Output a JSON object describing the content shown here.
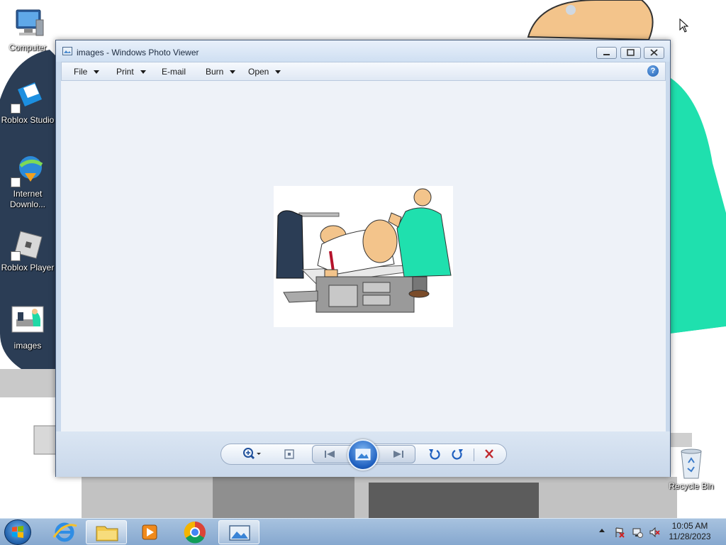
{
  "desktop": {
    "icons": [
      {
        "label": "Computer",
        "icon": "computer-icon"
      },
      {
        "label": "Roblox Studio",
        "icon": "roblox-studio-icon"
      },
      {
        "label": "Internet Downlo...",
        "icon": "internet-download-manager-icon"
      },
      {
        "label": "Roblox Player",
        "icon": "roblox-player-icon"
      },
      {
        "label": "images",
        "icon": "image-file-icon"
      },
      {
        "label": "Recycle Bin",
        "icon": "recycle-bin-icon"
      }
    ]
  },
  "window": {
    "title": "images - Windows Photo Viewer",
    "menu": [
      {
        "label": "File",
        "has_dropdown": true
      },
      {
        "label": "Print",
        "has_dropdown": true
      },
      {
        "label": "E-mail",
        "has_dropdown": false
      },
      {
        "label": "Burn",
        "has_dropdown": true
      },
      {
        "label": "Open",
        "has_dropdown": true
      }
    ],
    "help_symbol": "?",
    "toolbar": {
      "buttons": [
        "zoom-icon",
        "actual-size-icon",
        "previous-icon",
        "slideshow-icon",
        "next-icon",
        "rotate-left-icon",
        "rotate-right-icon",
        "delete-icon"
      ]
    }
  },
  "taskbar": {
    "apps": [
      "file-explorer-icon",
      "internet-explorer-icon",
      "libraries-icon",
      "media-player-icon",
      "chrome-icon",
      "photo-viewer-icon"
    ],
    "active_app": "photo-viewer-icon",
    "clock": {
      "time": "10:05 AM",
      "date": "11/28/2023"
    }
  },
  "colors": {
    "viewer_background": "#eef2f8",
    "toolbar_accent": "#1e5fbf",
    "delete_red": "#c0282d",
    "doctor_coat": "#1fd9a6"
  }
}
